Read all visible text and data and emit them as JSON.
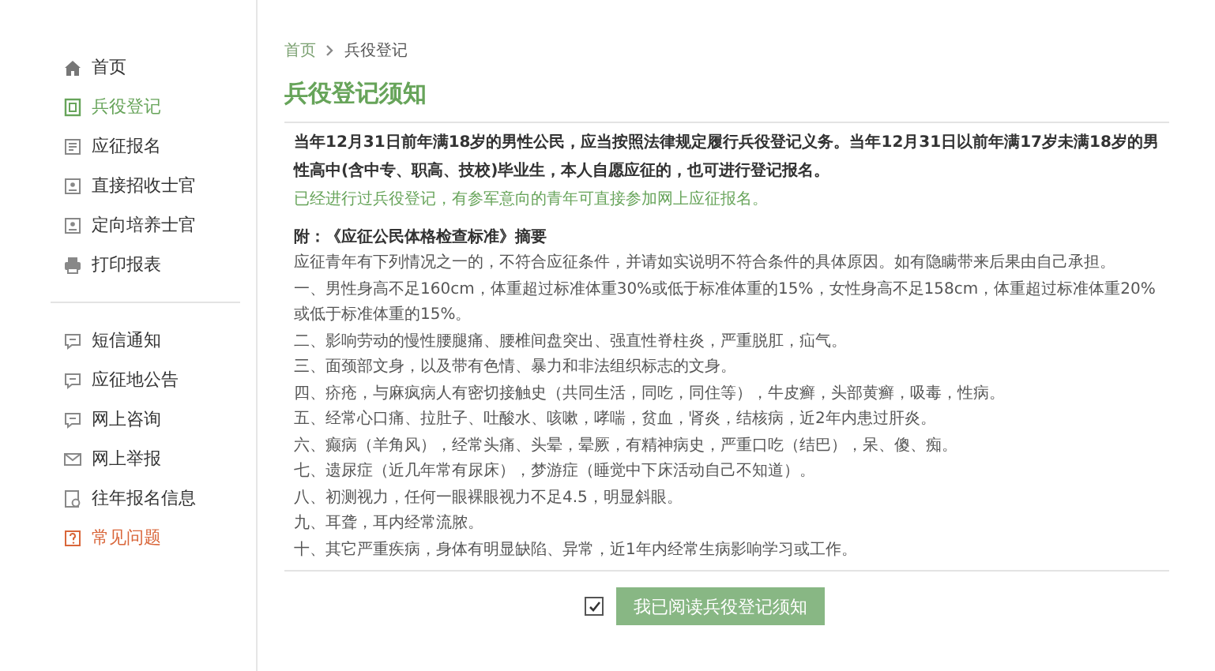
{
  "sidebar": {
    "groups": [
      {
        "items": [
          {
            "label": "首页",
            "selected": false,
            "highlighted": false
          },
          {
            "label": "兵役登记",
            "selected": true,
            "highlighted": false
          },
          {
            "label": "应征报名",
            "selected": false,
            "highlighted": false
          },
          {
            "label": "直接招收士官",
            "selected": false,
            "highlighted": false
          },
          {
            "label": "定向培养士官",
            "selected": false,
            "highlighted": false
          },
          {
            "label": "打印报表",
            "selected": false,
            "highlighted": false
          }
        ]
      },
      {
        "items": [
          {
            "label": "短信通知",
            "selected": false,
            "highlighted": false
          },
          {
            "label": "应征地公告",
            "selected": false,
            "highlighted": false
          },
          {
            "label": "网上咨询",
            "selected": false,
            "highlighted": false
          },
          {
            "label": "网上举报",
            "selected": false,
            "highlighted": false
          },
          {
            "label": "往年报名信息",
            "selected": false,
            "highlighted": false
          },
          {
            "label": "常见问题",
            "selected": false,
            "highlighted": true
          }
        ]
      }
    ]
  },
  "breadcrumb": [
    {
      "label": "首页"
    },
    {
      "label": "兵役登记"
    }
  ],
  "title": "兵役登记须知",
  "notice": {
    "text": "当年12月31日前年满18岁的男性公民，应当按照法律规定履行兵役登记义务。当年12月31日以前年满17岁未满18岁的男性高中(含中专、职高、技校)毕业生，本人自愿应征的，也可进行登记报名。",
    "note": "已经进行过兵役登记，有参军意向的青年可直接参加网上应征报名。"
  },
  "appendix": {
    "heading": "附：《应征公民体格检查标准》摘要",
    "intro": "应征青年有下列情况之一的，不符合应征条件，并请如实说明不符合条件的具体原因。如有隐瞒带来后果由自己承担。",
    "items": [
      "一、男性身高不足160cm，体重超过标准体重30%或低于标准体重的15%，女性身高不足158cm，体重超过标准体重20%或低于标准体重的15%。",
      "二、影响劳动的慢性腰腿痛、腰椎间盘突出、强直性脊柱炎，严重脱肛，疝气。",
      "三、面颈部文身，以及带有色情、暴力和非法组织标志的文身。",
      "四、疥疮，与麻疯病人有密切接触史（共同生活，同吃，同住等），牛皮癣，头部黄癣，吸毒，性病。",
      "五、经常心口痛、拉肚子、吐酸水、咳嗽，哮喘，贫血，肾炎，结核病，近2年内患过肝炎。",
      "六、癫病（羊角风），经常头痛、头晕，晕厥，有精神病史，严重口吃（结巴），呆、傻、痴。",
      "七、遗尿症（近几年常有尿床），梦游症（睡觉中下床活动自己不知道）。",
      "八、初测视力，任何一眼裸眼视力不足4.5，明显斜眼。",
      "九、耳聋，耳内经常流脓。",
      "十、其它严重疾病，身体有明显缺陷、异常，近1年内经常生病影响学习或工作。"
    ]
  },
  "agreement": {
    "checked": true,
    "button": "我已阅读兵役登记须知"
  }
}
